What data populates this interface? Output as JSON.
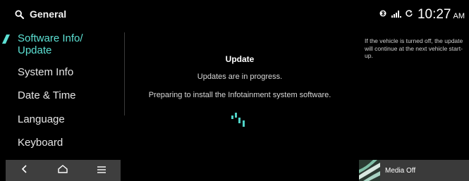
{
  "header": {
    "title": "General",
    "search_icon": "search-icon",
    "status_icons": [
      "bluetooth-phone-icon",
      "signal-icon",
      "sync-icon"
    ],
    "time": "10:27",
    "ampm": "AM"
  },
  "sidebar": {
    "items": [
      {
        "label_line1": "Software Info/",
        "label_line2": "Update",
        "active": true
      },
      {
        "label": "System Info",
        "active": false
      },
      {
        "label": "Date & Time",
        "active": false
      },
      {
        "label": "Language",
        "active": false
      },
      {
        "label": "Keyboard",
        "active": false
      }
    ]
  },
  "main": {
    "title": "Update",
    "status": "Updates are in progress.",
    "detail": "Preparing to install the Infotainment system software."
  },
  "note": {
    "text": "If the vehicle is turned off, the update will continue at the next vehicle start-up."
  },
  "bottom_nav": {
    "buttons": [
      "back-icon",
      "home-icon",
      "menu-icon"
    ]
  },
  "media": {
    "label": "Media Off"
  },
  "colors": {
    "accent": "#5ce0d3",
    "background": "#000000",
    "nav_bg": "#3e3e3e"
  }
}
